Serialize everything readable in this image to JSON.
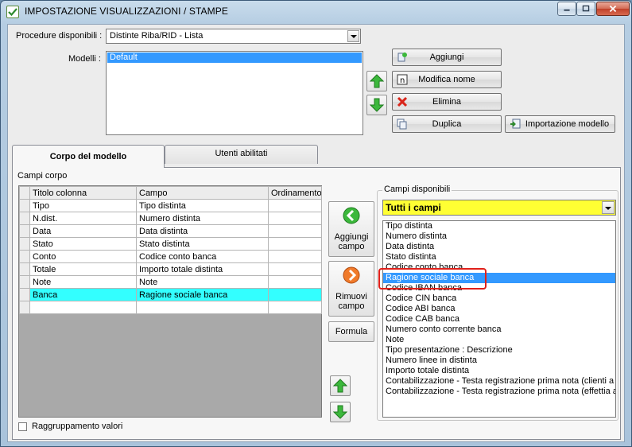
{
  "window": {
    "title": "IMPOSTAZIONE VISUALIZZAZIONI / STAMPE"
  },
  "top": {
    "procedure_label": "Procedure disponibili :",
    "procedure_value": "Distinte Riba/RID - Lista",
    "modelli_label": "Modelli :",
    "modelli_items": [
      "Default"
    ],
    "buttons": {
      "aggiungi": "Aggiungi",
      "modifica_nome": "Modifica nome",
      "elimina": "Elimina",
      "duplica": "Duplica",
      "importazione_modello": "Importazione modello"
    }
  },
  "tabs": [
    {
      "label": "Corpo del modello",
      "active": true
    },
    {
      "label": "Utenti abilitati",
      "active": false
    }
  ],
  "corpo": {
    "campi_corpo_label": "Campi corpo",
    "columns": [
      "Titolo colonna",
      "Campo",
      "Ordinamento"
    ],
    "rows": [
      {
        "titolo": "Tipo",
        "campo": "Tipo distinta",
        "ordinamento": ""
      },
      {
        "titolo": "N.dist.",
        "campo": "Numero distinta",
        "ordinamento": ""
      },
      {
        "titolo": "Data",
        "campo": "Data distinta",
        "ordinamento": ""
      },
      {
        "titolo": "Stato",
        "campo": "Stato distinta",
        "ordinamento": ""
      },
      {
        "titolo": "Conto",
        "campo": "Codice conto banca",
        "ordinamento": ""
      },
      {
        "titolo": "Totale",
        "campo": "Importo totale distinta",
        "ordinamento": ""
      },
      {
        "titolo": "Note",
        "campo": "Note",
        "ordinamento": ""
      },
      {
        "titolo": "Banca",
        "campo": "Ragione sociale banca",
        "ordinamento": "",
        "highlight": true
      },
      {
        "titolo": "",
        "campo": "",
        "ordinamento": ""
      }
    ],
    "aggiungi_campo_label": [
      "Aggiungi",
      "campo"
    ],
    "rimuovi_campo_label": [
      "Rimuovi",
      "campo"
    ],
    "formula_label": "Formula",
    "raggruppamento_label": "Raggruppamento valori"
  },
  "disponibili": {
    "group_label": "Campi disponibili",
    "filter_value": "Tutti i campi",
    "items": [
      "Tipo distinta",
      "Numero distinta",
      "Data distinta",
      "Stato distinta",
      "Codice conto banca",
      "Ragione sociale banca",
      "Codice IBAN banca",
      "Codice CIN banca",
      "Codice ABI banca",
      "Codice CAB banca",
      "Numero conto corrente banca",
      "Note",
      "Tipo presentazione : Descrizione",
      "Numero linee in distinta",
      "Importo totale distinta",
      "Contabilizzazione - Testa registrazione prima nota (clienti a eff",
      "Contabilizzazione - Testa registrazione prima nota (effettia a ba"
    ],
    "selected_index": 5
  },
  "colors": {
    "selection": "#3399ff",
    "row_highlight": "#33ffff",
    "filter_bg": "#ffff33",
    "annotation": "#e0201a"
  }
}
